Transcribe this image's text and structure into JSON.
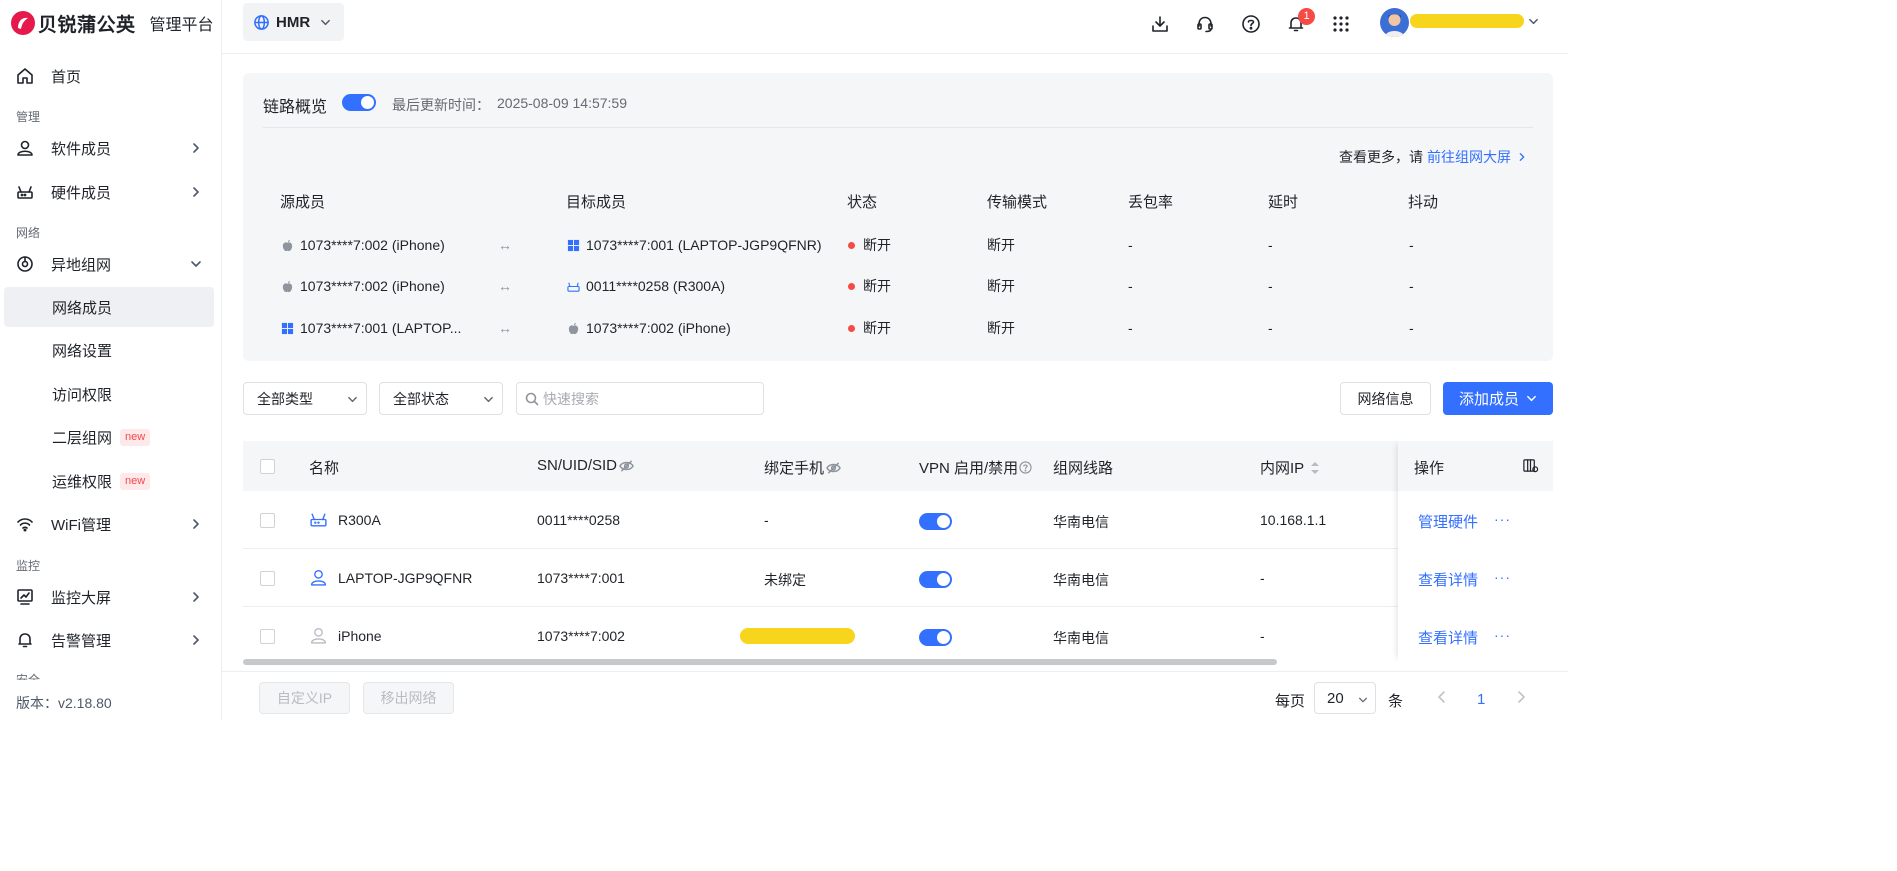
{
  "brand": {
    "name": "贝锐蒲公英",
    "subtitle": "管理平台"
  },
  "sidebar": {
    "home": "首页",
    "sections": {
      "manage": "管理",
      "network": "网络",
      "monitor": "监控",
      "security": "安全"
    },
    "items": {
      "software_members": "软件成员",
      "hardware_members": "硬件成员",
      "remote_network": "异地组网",
      "network_members": "网络成员",
      "network_settings": "网络设置",
      "access_rights": "访问权限",
      "layer2_network": "二层组网",
      "ops_rights": "运维权限",
      "wifi_manage": "WiFi管理",
      "monitor_screen": "监控大屏",
      "alert_manage": "告警管理"
    },
    "new_badge": "new",
    "version": "版本：v2.18.80"
  },
  "header": {
    "org": "HMR",
    "notification_count": "1"
  },
  "overview": {
    "title": "链路概览",
    "toggle_on": true,
    "last_update_label": "最后更新时间：",
    "last_update": "2025-08-09 14:57:59",
    "more_prefix": "查看更多，请",
    "more_link": "前往组网大屏",
    "columns": [
      "源成员",
      "目标成员",
      "状态",
      "传输模式",
      "丢包率",
      "延时",
      "抖动"
    ],
    "rows": [
      {
        "src_icon": "apple-icon",
        "source": "1073****7:002 (iPhone)",
        "arrow": "↔",
        "dst_icon": "windows-icon",
        "target": "1073****7:001 (LAPTOP-JGP9QFNR)",
        "status": "断开",
        "mode": "断开",
        "loss": "-",
        "latency": "-",
        "jitter": "-"
      },
      {
        "src_icon": "apple-icon",
        "source": "1073****7:002 (iPhone)",
        "arrow": "↔",
        "dst_icon": "router-icon",
        "target": "0011****0258 (R300A)",
        "status": "断开",
        "mode": "断开",
        "loss": "-",
        "latency": "-",
        "jitter": "-"
      },
      {
        "src_icon": "windows-icon",
        "source": "1073****7:001 (LAPTOP...",
        "arrow": "↔",
        "dst_icon": "apple-icon",
        "target": "1073****7:002 (iPhone)",
        "status": "断开",
        "mode": "断开",
        "loss": "-",
        "latency": "-",
        "jitter": "-"
      }
    ],
    "colors": {
      "status_dot": "#f54a45"
    }
  },
  "toolbar": {
    "type_filter": "全部类型",
    "status_filter": "全部状态",
    "search_placeholder": "快速搜索",
    "network_info": "网络信息",
    "add_member": "添加成员"
  },
  "table": {
    "columns": {
      "name": "名称",
      "sn": "SN/UID/SID",
      "phone": "绑定手机",
      "vpn": "VPN 启用/禁用",
      "route": "组网线路",
      "ip": "内网IP",
      "ops": "操作"
    },
    "rows": [
      {
        "icon": "router-icon",
        "name": "R300A",
        "sn": "0011****0258",
        "phone": "-",
        "vpn_enabled": true,
        "route": "华南电信",
        "ip": "10.168.1.1",
        "action": "管理硬件",
        "more": "···"
      },
      {
        "icon": "user-icon",
        "name": "LAPTOP-JGP9QFNR",
        "sn": "1073****7:001",
        "phone": "未绑定",
        "vpn_enabled": true,
        "route": "华南电信",
        "ip": "-",
        "action": "查看详情",
        "more": "···"
      },
      {
        "icon": "user-gray-icon",
        "name": "iPhone",
        "sn": "1073****7:002",
        "phone": "",
        "vpn_enabled": true,
        "route": "华南电信",
        "ip": "-",
        "action": "查看详情",
        "more": "···"
      }
    ]
  },
  "footer": {
    "custom_ip": "自定义IP",
    "remove_network": "移出网络",
    "per_page_label": "每页",
    "page_size": "20",
    "unit": "条",
    "current_page": "1"
  },
  "colors": {
    "accent": "#3370ff",
    "badge": "#f54a45",
    "redaction": "#f7d51c"
  }
}
